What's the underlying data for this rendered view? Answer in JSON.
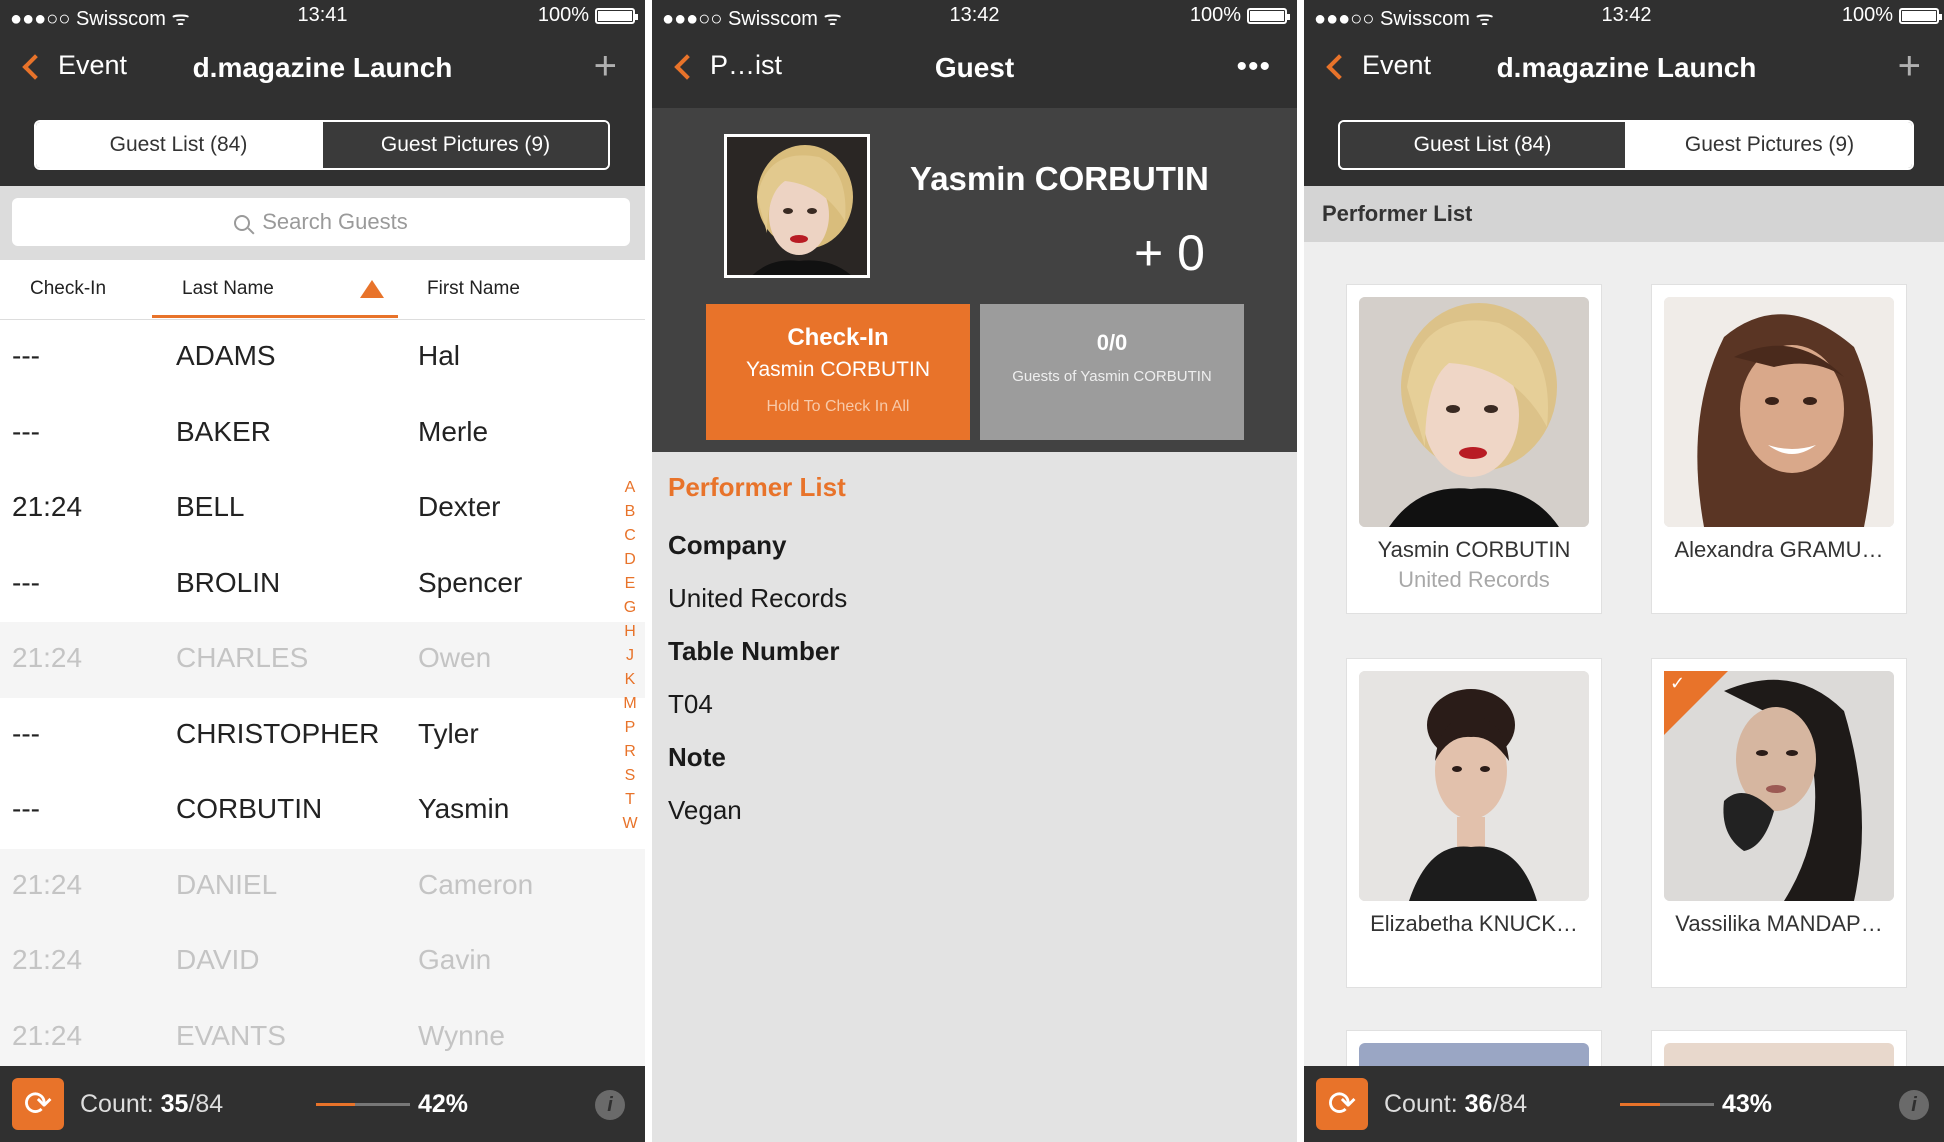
{
  "theme": {
    "accent": "#e8732a",
    "bar": "#303030"
  },
  "status": {
    "carrier": "●●●○○ Swisscom ᯤ",
    "battery": "100%",
    "s1_time": "13:41",
    "s2_time": "13:42",
    "s3_time": "13:42"
  },
  "screen1": {
    "back_label": "Event",
    "title": "d.magazine Launch",
    "tabs": [
      "Guest List (84)",
      "Guest Pictures (9)"
    ],
    "search_placeholder": "Search Guests",
    "columns": [
      "Check-In",
      "Last Name",
      "First Name"
    ],
    "rows": [
      {
        "checkin": "---",
        "last": "ADAMS",
        "first": "Hal",
        "checked": false
      },
      {
        "checkin": "---",
        "last": "BAKER",
        "first": "Merle",
        "checked": false
      },
      {
        "checkin": "21:24",
        "last": "BELL",
        "first": "Dexter",
        "checked": false
      },
      {
        "checkin": "---",
        "last": "BROLIN",
        "first": "Spencer",
        "checked": false
      },
      {
        "checkin": "21:24",
        "last": "CHARLES",
        "first": "Owen",
        "checked": true
      },
      {
        "checkin": "---",
        "last": "CHRISTOPHER",
        "first": "Tyler",
        "checked": false
      },
      {
        "checkin": "---",
        "last": "CORBUTIN",
        "first": "Yasmin",
        "checked": false
      },
      {
        "checkin": "21:24",
        "last": "DANIEL",
        "first": "Cameron",
        "checked": true
      },
      {
        "checkin": "21:24",
        "last": "DAVID",
        "first": "Gavin",
        "checked": true
      },
      {
        "checkin": "21:24",
        "last": "EVANTS",
        "first": "Wynne",
        "checked": true
      }
    ],
    "index_letters": [
      "A",
      "B",
      "C",
      "D",
      "E",
      "G",
      "H",
      "J",
      "K",
      "M",
      "P",
      "R",
      "S",
      "T",
      "W"
    ],
    "footer": {
      "count_label": "Count:",
      "count_num": "35",
      "count_total": "/84",
      "percent": "42%",
      "progress": 0.42
    }
  },
  "screen2": {
    "back_label": "P…ist",
    "title": "Guest",
    "more_icon": "•••",
    "guest_name": "Yasmin CORBUTIN",
    "plus_guests": "+ 0",
    "checkin_button": {
      "title": "Check-In",
      "name": "Yasmin CORBUTIN",
      "hint": "Hold To Check In All"
    },
    "guests_button": {
      "count": "0/0",
      "label": "Guests of Yasmin CORBUTIN"
    },
    "section": "Performer List",
    "fields": [
      {
        "label": "Company",
        "value": "United Records"
      },
      {
        "label": "Table Number",
        "value": "T04"
      },
      {
        "label": "Note",
        "value": "Vegan"
      }
    ]
  },
  "screen3": {
    "back_label": "Event",
    "title": "d.magazine Launch",
    "tabs": [
      "Guest List (84)",
      "Guest Pictures (9)"
    ],
    "section": "Performer List",
    "cards": [
      {
        "name": "Yasmin CORBUTIN",
        "company": "United Records",
        "checked": false
      },
      {
        "name": "Alexandra GRAMU…",
        "company": "",
        "checked": false
      },
      {
        "name": "Elizabetha KNUCK…",
        "company": "",
        "checked": false
      },
      {
        "name": "Vassilika MANDAP…",
        "company": "",
        "checked": true
      }
    ],
    "footer": {
      "count_label": "Count:",
      "count_num": "36",
      "count_total": "/84",
      "percent": "43%",
      "progress": 0.43
    }
  }
}
